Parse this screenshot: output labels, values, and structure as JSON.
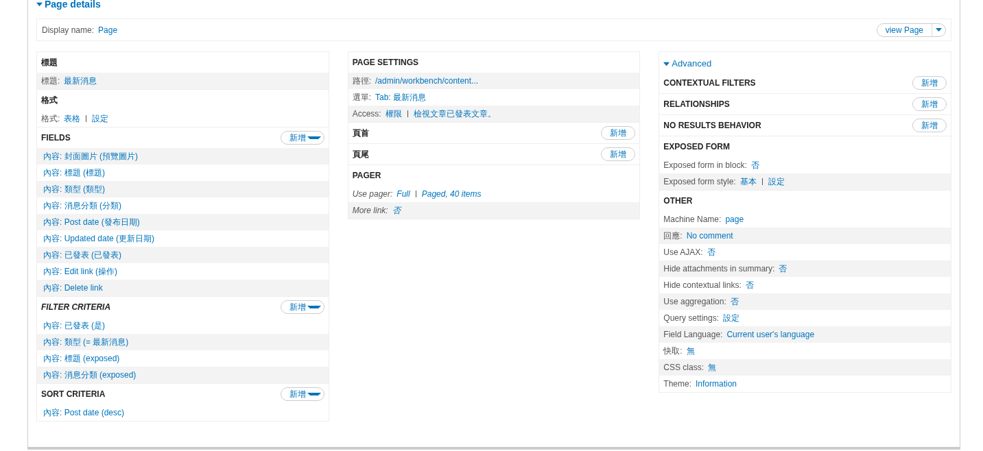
{
  "details": {
    "title": "Page details",
    "expanded": true
  },
  "display": {
    "label": "Display name:",
    "value": "Page",
    "button": "view Page"
  },
  "columns": [
    {
      "sections": [
        {
          "title": "標題",
          "rows": [
            {
              "kind": "setting",
              "label": "標題:",
              "values": [
                "最新消息"
              ],
              "shaded": true
            }
          ]
        },
        {
          "title": "格式",
          "rows": [
            {
              "kind": "setting",
              "label": "格式:",
              "values": [
                "表格",
                "設定"
              ],
              "shaded": false
            }
          ]
        },
        {
          "title": "FIELDS",
          "button": {
            "kind": "dropdown",
            "label": "新增"
          },
          "rows": [
            {
              "kind": "link",
              "text": "內容: 封面圖片 (預覽圖片)",
              "shaded": true
            },
            {
              "kind": "link",
              "text": "內容: 標題 (標題)",
              "shaded": false
            },
            {
              "kind": "link",
              "text": "內容: 類型 (類型)",
              "shaded": true
            },
            {
              "kind": "link",
              "text": "內容: 消息分類 (分類)",
              "shaded": false
            },
            {
              "kind": "link",
              "text": "內容: Post date (發布日期)",
              "shaded": true
            },
            {
              "kind": "link",
              "text": "內容: Updated date (更新日期)",
              "shaded": false
            },
            {
              "kind": "link",
              "text": "內容: 已發表 (已發表)",
              "shaded": true
            },
            {
              "kind": "link",
              "text": "內容: Edit link (操作)",
              "shaded": false
            },
            {
              "kind": "link",
              "text": "內容: Delete link",
              "shaded": true
            }
          ]
        },
        {
          "title": "FILTER CRITERIA",
          "italic": true,
          "button": {
            "kind": "dropdown",
            "label": "新增"
          },
          "rows": [
            {
              "kind": "link",
              "text": "內容: 已發表 (是)",
              "shaded": false
            },
            {
              "kind": "link",
              "text": "內容: 類型 (= 最新消息)",
              "shaded": true
            },
            {
              "kind": "link",
              "text": "內容: 標題 (exposed)",
              "shaded": false
            },
            {
              "kind": "link",
              "text": "內容: 消息分類 (exposed)",
              "shaded": true
            }
          ]
        },
        {
          "title": "SORT CRITERIA",
          "button": {
            "kind": "dropdown",
            "label": "新增"
          },
          "rows": [
            {
              "kind": "link",
              "text": "內容: Post date (desc)",
              "shaded": false
            }
          ]
        }
      ]
    },
    {
      "sections": [
        {
          "title": "PAGE SETTINGS",
          "rows": [
            {
              "kind": "setting",
              "label": "路徑:",
              "values": [
                "/admin/workbench/content..."
              ],
              "shaded": true
            },
            {
              "kind": "setting",
              "label": "選單:",
              "values": [
                "Tab: 最新消息"
              ],
              "shaded": false
            },
            {
              "kind": "setting",
              "label": "Access:",
              "values": [
                "權限",
                "檢視文章已發表文章。"
              ],
              "shaded": true
            }
          ]
        },
        {
          "title": "頁首",
          "button": {
            "kind": "plain",
            "label": "新增"
          }
        },
        {
          "title": "頁尾",
          "button": {
            "kind": "plain",
            "label": "新增"
          }
        },
        {
          "title": "PAGER",
          "rows": [
            {
              "kind": "setting",
              "label": "Use pager:",
              "values": [
                "Full",
                "Paged, 40 items"
              ],
              "italic": true,
              "shaded": false
            },
            {
              "kind": "setting",
              "label": "More link:",
              "values": [
                "否"
              ],
              "italic": true,
              "shaded": true
            }
          ]
        }
      ]
    },
    {
      "advanced": {
        "label": "Advanced",
        "expanded": true
      },
      "sections": [
        {
          "title": "CONTEXTUAL FILTERS",
          "button": {
            "kind": "plain",
            "label": "新增"
          }
        },
        {
          "title": "RELATIONSHIPS",
          "button": {
            "kind": "plain",
            "label": "新增"
          }
        },
        {
          "title": "NO RESULTS BEHAVIOR",
          "button": {
            "kind": "plain",
            "label": "新增"
          }
        },
        {
          "title": "EXPOSED FORM",
          "rows": [
            {
              "kind": "setting",
              "label": "Exposed form in block:",
              "values": [
                "否"
              ],
              "shaded": false
            },
            {
              "kind": "setting",
              "label": "Exposed form style:",
              "values": [
                "基本",
                "設定"
              ],
              "shaded": true
            }
          ]
        },
        {
          "title": "OTHER",
          "rows": [
            {
              "kind": "setting",
              "label": "Machine Name:",
              "values": [
                "page"
              ],
              "shaded": false
            },
            {
              "kind": "setting",
              "label": "回應:",
              "values": [
                "No comment"
              ],
              "shaded": true
            },
            {
              "kind": "setting",
              "label": "Use AJAX:",
              "values": [
                "否"
              ],
              "shaded": false
            },
            {
              "kind": "setting",
              "label": "Hide attachments in summary:",
              "values": [
                "否"
              ],
              "shaded": true
            },
            {
              "kind": "setting",
              "label": "Hide contextual links:",
              "values": [
                "否"
              ],
              "shaded": false
            },
            {
              "kind": "setting",
              "label": "Use aggregation:",
              "values": [
                "否"
              ],
              "shaded": true
            },
            {
              "kind": "setting",
              "label": "Query settings:",
              "values": [
                "設定"
              ],
              "shaded": false
            },
            {
              "kind": "setting",
              "label": "Field Language:",
              "values": [
                "Current user's language"
              ],
              "shaded": true
            },
            {
              "kind": "setting",
              "label": "快取:",
              "values": [
                "無"
              ],
              "shaded": false
            },
            {
              "kind": "setting",
              "label": "CSS class:",
              "values": [
                "無"
              ],
              "shaded": true
            },
            {
              "kind": "setting",
              "label": "Theme:",
              "values": [
                "Information"
              ],
              "shaded": false
            }
          ]
        }
      ]
    }
  ]
}
